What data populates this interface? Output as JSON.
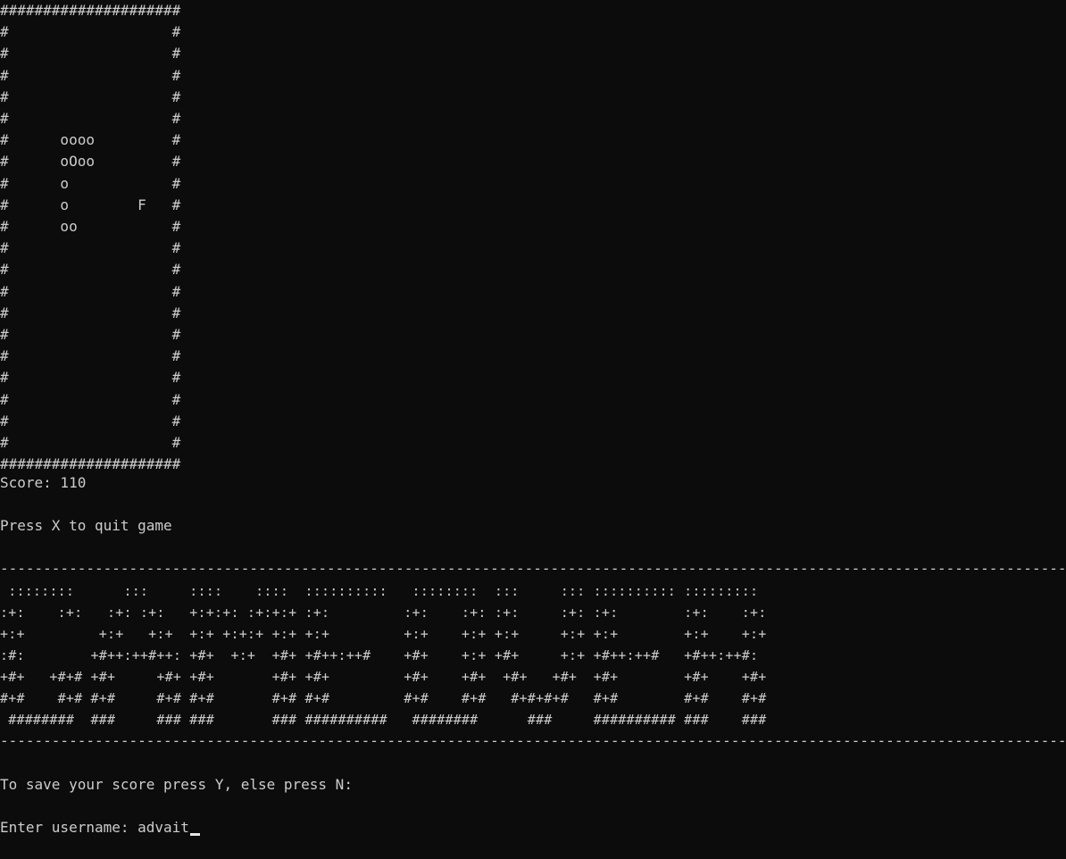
{
  "board": {
    "rows": [
      "#####################",
      "#                   #",
      "#                   #",
      "#                   #",
      "#                   #",
      "#                   #",
      "#      oooo         #",
      "#      oOoo         #",
      "#      o            #",
      "#      o        F   #",
      "#      oo           #",
      "#                   #",
      "#                   #",
      "#                   #",
      "#                   #",
      "#                   #",
      "#                   #",
      "#                   #",
      "#                   #",
      "#                   #",
      "#                   #",
      "#####################"
    ]
  },
  "score_text": "Score: 110",
  "quit_hint": "Press X to quit game",
  "divider": "-----------------------------------------------------------------------------------------------------------------------------------",
  "game_over_banner": " ::::::::      :::     ::::    ::::  ::::::::::   ::::::::  :::     ::: :::::::::: :::::::::\n:+:    :+:   :+: :+:   +:+:+: :+:+:+ :+:         :+:    :+: :+:     :+: :+:        :+:    :+:\n+:+         +:+   +:+  +:+ +:+:+ +:+ +:+         +:+    +:+ +:+     +:+ +:+        +:+    +:+\n:#:        +#++:++#++: +#+  +:+  +#+ +#++:++#    +#+    +:+ +#+     +:+ +#++:++#   +#++:++#:\n+#+   +#+# +#+     +#+ +#+       +#+ +#+         +#+    +#+  +#+   +#+  +#+        +#+    +#+\n#+#    #+# #+#     #+# #+#       #+# #+#         #+#    #+#   #+#+#+#   #+#        #+#    #+#\n ########  ###     ### ###       ### ##########   ########      ###     ########## ###    ###",
  "save_prompt": "To save your score press Y, else press N:",
  "username_prompt": "Enter username: ",
  "username_value": "advait"
}
